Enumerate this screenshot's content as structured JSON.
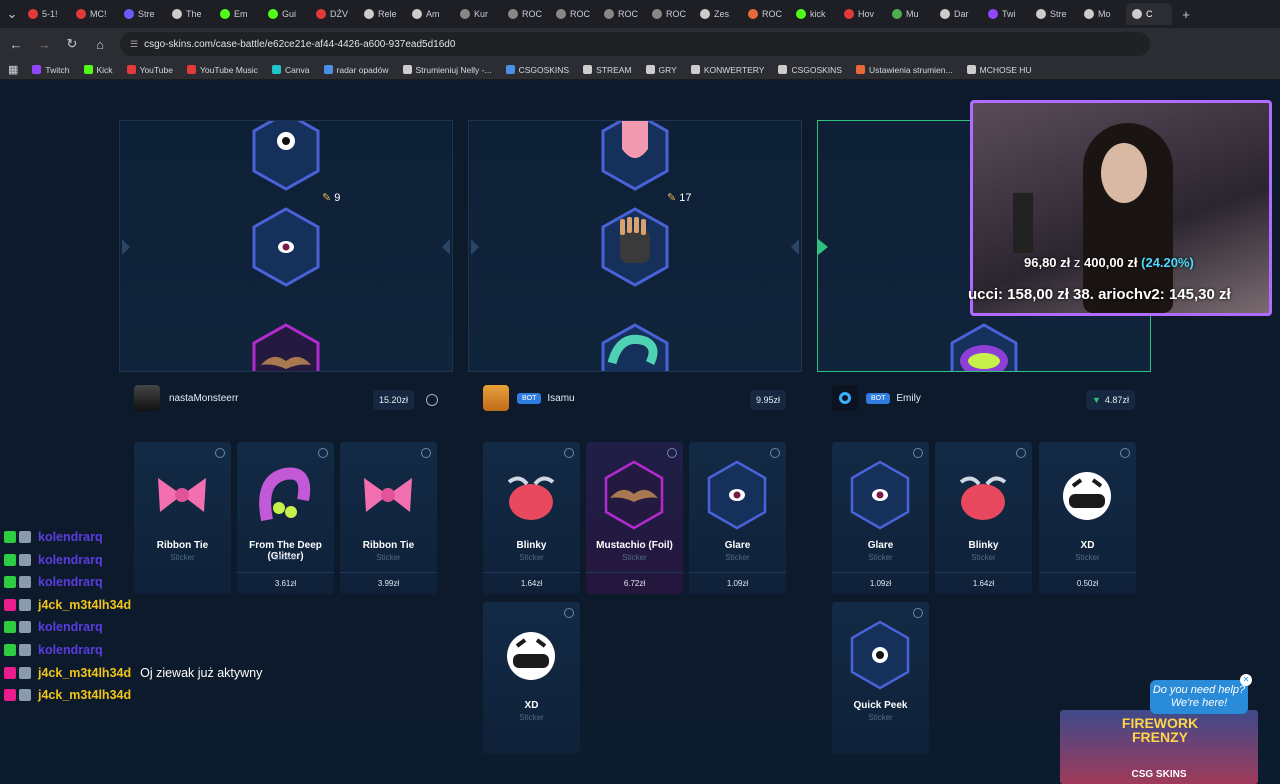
{
  "browser": {
    "tabs": [
      {
        "label": "5-1!",
        "color": "#e23b3b"
      },
      {
        "label": "MC!",
        "color": "#e23b3b"
      },
      {
        "label": "Stre",
        "color": "#6b5bff"
      },
      {
        "label": "The",
        "color": "#cccccc"
      },
      {
        "label": "Em",
        "color": "#53fc18"
      },
      {
        "label": "Gui",
        "color": "#53fc18"
      },
      {
        "label": "DŹV",
        "color": "#e23b3b"
      },
      {
        "label": "Rele",
        "color": "#cccccc"
      },
      {
        "label": "Am",
        "color": "#cccccc"
      },
      {
        "label": "Kur",
        "color": "#888888"
      },
      {
        "label": "ROC",
        "color": "#888888"
      },
      {
        "label": "ROC",
        "color": "#888888"
      },
      {
        "label": "ROC",
        "color": "#888888"
      },
      {
        "label": "ROC",
        "color": "#888888"
      },
      {
        "label": "Zes",
        "color": "#cccccc"
      },
      {
        "label": "ROC",
        "color": "#e86a3a"
      },
      {
        "label": "kick",
        "color": "#53fc18"
      },
      {
        "label": "Hov",
        "color": "#e23b3b"
      },
      {
        "label": "Mu",
        "color": "#4caf50"
      },
      {
        "label": "Dar",
        "color": "#cccccc"
      },
      {
        "label": "Twi",
        "color": "#9146ff"
      },
      {
        "label": "Stre",
        "color": "#cccccc"
      },
      {
        "label": "Mo",
        "color": "#cccccc"
      },
      {
        "label": "C",
        "color": "#cccccc"
      }
    ],
    "url": "csgo-skins.com/case-battle/e62ce21e-af44-4426-a600-937ead5d16d0",
    "bookmarks": [
      {
        "label": "Twitch",
        "color": "#9146ff"
      },
      {
        "label": "Kick",
        "color": "#53fc18"
      },
      {
        "label": "YouTube",
        "color": "#e23b3b"
      },
      {
        "label": "YouTube Music",
        "color": "#e23b3b"
      },
      {
        "label": "Canva",
        "color": "#20c4cb"
      },
      {
        "label": "radar opadów",
        "color": "#4a90e2"
      },
      {
        "label": "Strumieniuj Nelly -...",
        "color": "#cccccc"
      },
      {
        "label": "CSGOSKINS",
        "color": "#4a90e2"
      },
      {
        "label": "STREAM",
        "color": "#cccccc"
      },
      {
        "label": "GRY",
        "color": "#cccccc"
      },
      {
        "label": "KONWERTERY",
        "color": "#cccccc"
      },
      {
        "label": "CSGOSKINS",
        "color": "#cccccc"
      },
      {
        "label": "Ustawienia strumien...",
        "color": "#e86a3a"
      },
      {
        "label": "MCHOSE HU",
        "color": "#cccccc"
      }
    ]
  },
  "reels": [
    {
      "count": "9"
    },
    {
      "count": "17"
    },
    {
      "count": ""
    }
  ],
  "players": [
    {
      "name": "nastaMonsteerr",
      "amount": "15.20zł",
      "bot": false
    },
    {
      "name": "Isamu",
      "amount": "9.95zł",
      "bot": true,
      "badge": "BOT"
    },
    {
      "name": "Emily",
      "amount": "4.87zł",
      "bot": true,
      "badge": "BOT"
    }
  ],
  "cards": [
    {
      "name": "Ribbon Tie",
      "type": "Sticker",
      "price": "",
      "icon": "bow"
    },
    {
      "name": "From The Deep (Glitter)",
      "type": "Sticker",
      "price": "3.61zł",
      "icon": "tentacle"
    },
    {
      "name": "Ribbon Tie",
      "type": "Sticker",
      "price": "3.99zł",
      "icon": "bow"
    },
    {
      "name": "Blinky",
      "type": "Sticker",
      "price": "1.64zł",
      "icon": "blinky"
    },
    {
      "name": "Mustachio (Foil)",
      "type": "Sticker",
      "price": "6.72zł",
      "icon": "mustache"
    },
    {
      "name": "Glare",
      "type": "Sticker",
      "price": "1.09zł",
      "icon": "eye-hex"
    },
    {
      "name": "Glare",
      "type": "Sticker",
      "price": "1.09zł",
      "icon": "eye-hex"
    },
    {
      "name": "Blinky",
      "type": "Sticker",
      "price": "1.64zł",
      "icon": "blinky"
    },
    {
      "name": "XD",
      "type": "Sticker",
      "price": "0.50zł",
      "icon": "xd"
    },
    {
      "name": "XD",
      "type": "Sticker",
      "price": "",
      "icon": "xd"
    },
    {
      "name": "Quick Peek",
      "type": "Sticker",
      "price": "",
      "icon": "peek-hex"
    }
  ],
  "chat": [
    {
      "user": "kolendrarq",
      "msg": "",
      "color": "#5a3de0",
      "badge": "#2ecc40"
    },
    {
      "user": "kolendrarq",
      "msg": "",
      "color": "#5a3de0",
      "badge": "#2ecc40"
    },
    {
      "user": "kolendrarq",
      "msg": "",
      "color": "#5a3de0",
      "badge": "#2ecc40"
    },
    {
      "user": "j4ck_m3t4lh34d",
      "msg": "",
      "color": "#f0c419",
      "badge": "#e91e8c"
    },
    {
      "user": "kolendrarq",
      "msg": "",
      "color": "#5a3de0",
      "badge": "#2ecc40"
    },
    {
      "user": "kolendrarq",
      "msg": "",
      "color": "#5a3de0",
      "badge": "#2ecc40"
    },
    {
      "user": "j4ck_m3t4lh34d",
      "msg": "Oj ziewak już aktywny",
      "color": "#f0c419",
      "badge": "#e91e8c"
    },
    {
      "user": "j4ck_m3t4lh34d",
      "msg": "",
      "color": "#f0c419",
      "badge": "#e91e8c"
    }
  ],
  "stream": {
    "goal_current": "96,80 zł",
    "goal_sep": "z",
    "goal_total": "400,00 zł",
    "goal_pct": "(24.20%)",
    "goal_fraction": 0.242,
    "ticker": "ucci: 158,00 zł   38. ariochv2: 145,30 zł"
  },
  "help": {
    "line1": "Do you need help?",
    "line2": "We're here!"
  },
  "ad": {
    "title": "FIREWORK FRENZY",
    "brand": "CSG SKINS"
  }
}
